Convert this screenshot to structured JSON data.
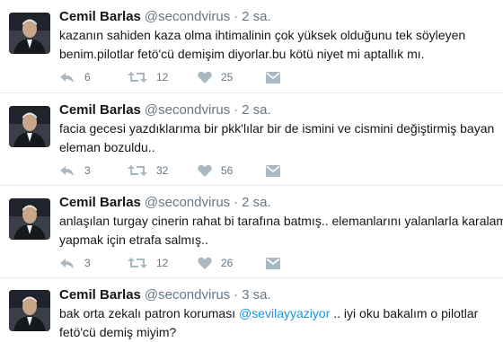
{
  "author": {
    "name": "Cemil Barlas",
    "handle": "@secondvirus"
  },
  "separator": "·",
  "colors": {
    "muted": "#657786",
    "link": "#1b95e0",
    "divider": "#e6ecf0"
  },
  "icons": {
    "reply": "reply-icon",
    "retweet": "retweet-icon",
    "like": "heart-icon",
    "dm": "envelope-icon"
  },
  "tweets": [
    {
      "time": "2 sa.",
      "line1": "kazanın sahiden kaza olma ihtimalinin çok yüksek olduğunu tek söyleyen",
      "line2": "benim.pilotlar fetö'cü demişim diyorlar.bu kötü niyet mi aptallık mı.",
      "replies": "6",
      "retweets": "12",
      "likes": "25"
    },
    {
      "time": "2 sa.",
      "line1": "facia gecesi yazdıklarıma bir pkk'lılar bir de ismini ve cismini değiştirmiş bayan",
      "line2": "eleman bozuldu..",
      "replies": "3",
      "retweets": "32",
      "likes": "56"
    },
    {
      "time": "2 sa.",
      "line1": "anlaşılan turgay cinerin rahat bi tarafına batmış.. elemanlarını yalanlarla karalama",
      "line2": "yapmak için etrafa salmış..",
      "replies": "3",
      "retweets": "12",
      "likes": "26"
    },
    {
      "time": "3 sa.",
      "line1_before": "bak orta zekalı patron koruması ",
      "line1_mention": "@sevilayyaziyor",
      "line1_after": " .. iyi oku bakalım o pilotlar",
      "line2": "fetö'cü demiş miyim?"
    }
  ]
}
